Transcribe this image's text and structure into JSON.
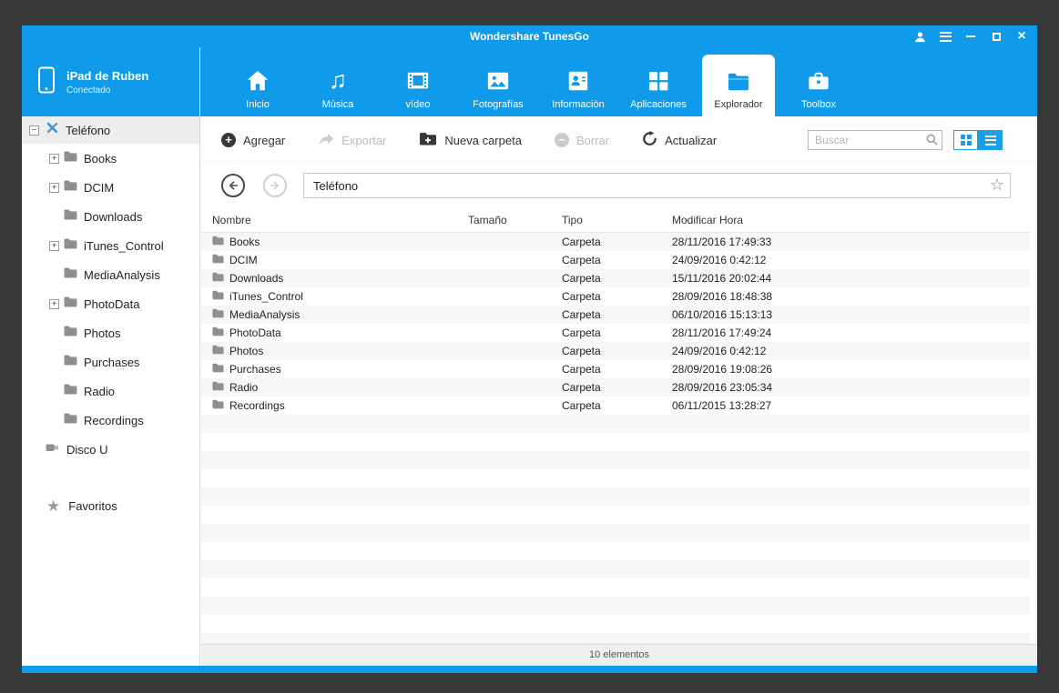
{
  "window": {
    "title": "Wondershare TunesGo"
  },
  "device": {
    "name": "iPad de Ruben",
    "status": "Conectado"
  },
  "nav": {
    "selected_index": 6,
    "items": [
      {
        "label": "Inicio",
        "icon": "home-icon"
      },
      {
        "label": "Música",
        "icon": "music-icon"
      },
      {
        "label": "vídeo",
        "icon": "video-icon"
      },
      {
        "label": "Fotografías",
        "icon": "photos-icon"
      },
      {
        "label": "Información",
        "icon": "contacts-icon"
      },
      {
        "label": "Aplicaciones",
        "icon": "apps-icon"
      },
      {
        "label": "Explorador",
        "icon": "folder-icon"
      },
      {
        "label": "Toolbox",
        "icon": "toolbox-icon"
      }
    ]
  },
  "sidebar": {
    "root": {
      "label": "Teléfono"
    },
    "items": [
      {
        "label": "Books",
        "expandable": true
      },
      {
        "label": "DCIM",
        "expandable": true
      },
      {
        "label": "Downloads",
        "expandable": false
      },
      {
        "label": "iTunes_Control",
        "expandable": true
      },
      {
        "label": "MediaAnalysis",
        "expandable": false
      },
      {
        "label": "PhotoData",
        "expandable": true
      },
      {
        "label": "Photos",
        "expandable": false
      },
      {
        "label": "Purchases",
        "expandable": false
      },
      {
        "label": "Radio",
        "expandable": false
      },
      {
        "label": "Recordings",
        "expandable": false
      }
    ],
    "disco": {
      "label": "Disco U"
    },
    "favorites": {
      "label": "Favoritos"
    }
  },
  "toolbar": {
    "add_label": "Agregar",
    "export_label": "Exportar",
    "new_folder_label": "Nueva carpeta",
    "delete_label": "Borrar",
    "refresh_label": "Actualizar",
    "search_placeholder": "Buscar"
  },
  "pathbar": {
    "path": "Teléfono"
  },
  "table": {
    "columns": [
      "Nombre",
      "Tamaño",
      "Tipo",
      "Modificar Hora"
    ],
    "rows": [
      {
        "name": "Books",
        "size": "",
        "type": "Carpeta",
        "modified": "28/11/2016 17:49:33"
      },
      {
        "name": "DCIM",
        "size": "",
        "type": "Carpeta",
        "modified": "24/09/2016 0:42:12"
      },
      {
        "name": "Downloads",
        "size": "",
        "type": "Carpeta",
        "modified": "15/11/2016 20:02:44"
      },
      {
        "name": "iTunes_Control",
        "size": "",
        "type": "Carpeta",
        "modified": "28/09/2016 18:48:38"
      },
      {
        "name": "MediaAnalysis",
        "size": "",
        "type": "Carpeta",
        "modified": "06/10/2016 15:13:13"
      },
      {
        "name": "PhotoData",
        "size": "",
        "type": "Carpeta",
        "modified": "28/11/2016 17:49:24"
      },
      {
        "name": "Photos",
        "size": "",
        "type": "Carpeta",
        "modified": "24/09/2016 0:42:12"
      },
      {
        "name": "Purchases",
        "size": "",
        "type": "Carpeta",
        "modified": "28/09/2016 19:08:26"
      },
      {
        "name": "Radio",
        "size": "",
        "type": "Carpeta",
        "modified": "28/09/2016 23:05:34"
      },
      {
        "name": "Recordings",
        "size": "",
        "type": "Carpeta",
        "modified": "06/11/2015 13:28:27"
      }
    ]
  },
  "statusbar": {
    "text": "10 elementos"
  },
  "icons": {
    "search": "magnifier",
    "favorite_path": "☆",
    "favorites_sidebar": "★",
    "add": "+",
    "delete": "−",
    "menu": "≡",
    "close": "×"
  },
  "colors": {
    "accent": "#0f9bea",
    "toolbar_icon_dark": "#383838",
    "disabled": "#bdbdbd",
    "stripe": "#f6f6f6"
  }
}
